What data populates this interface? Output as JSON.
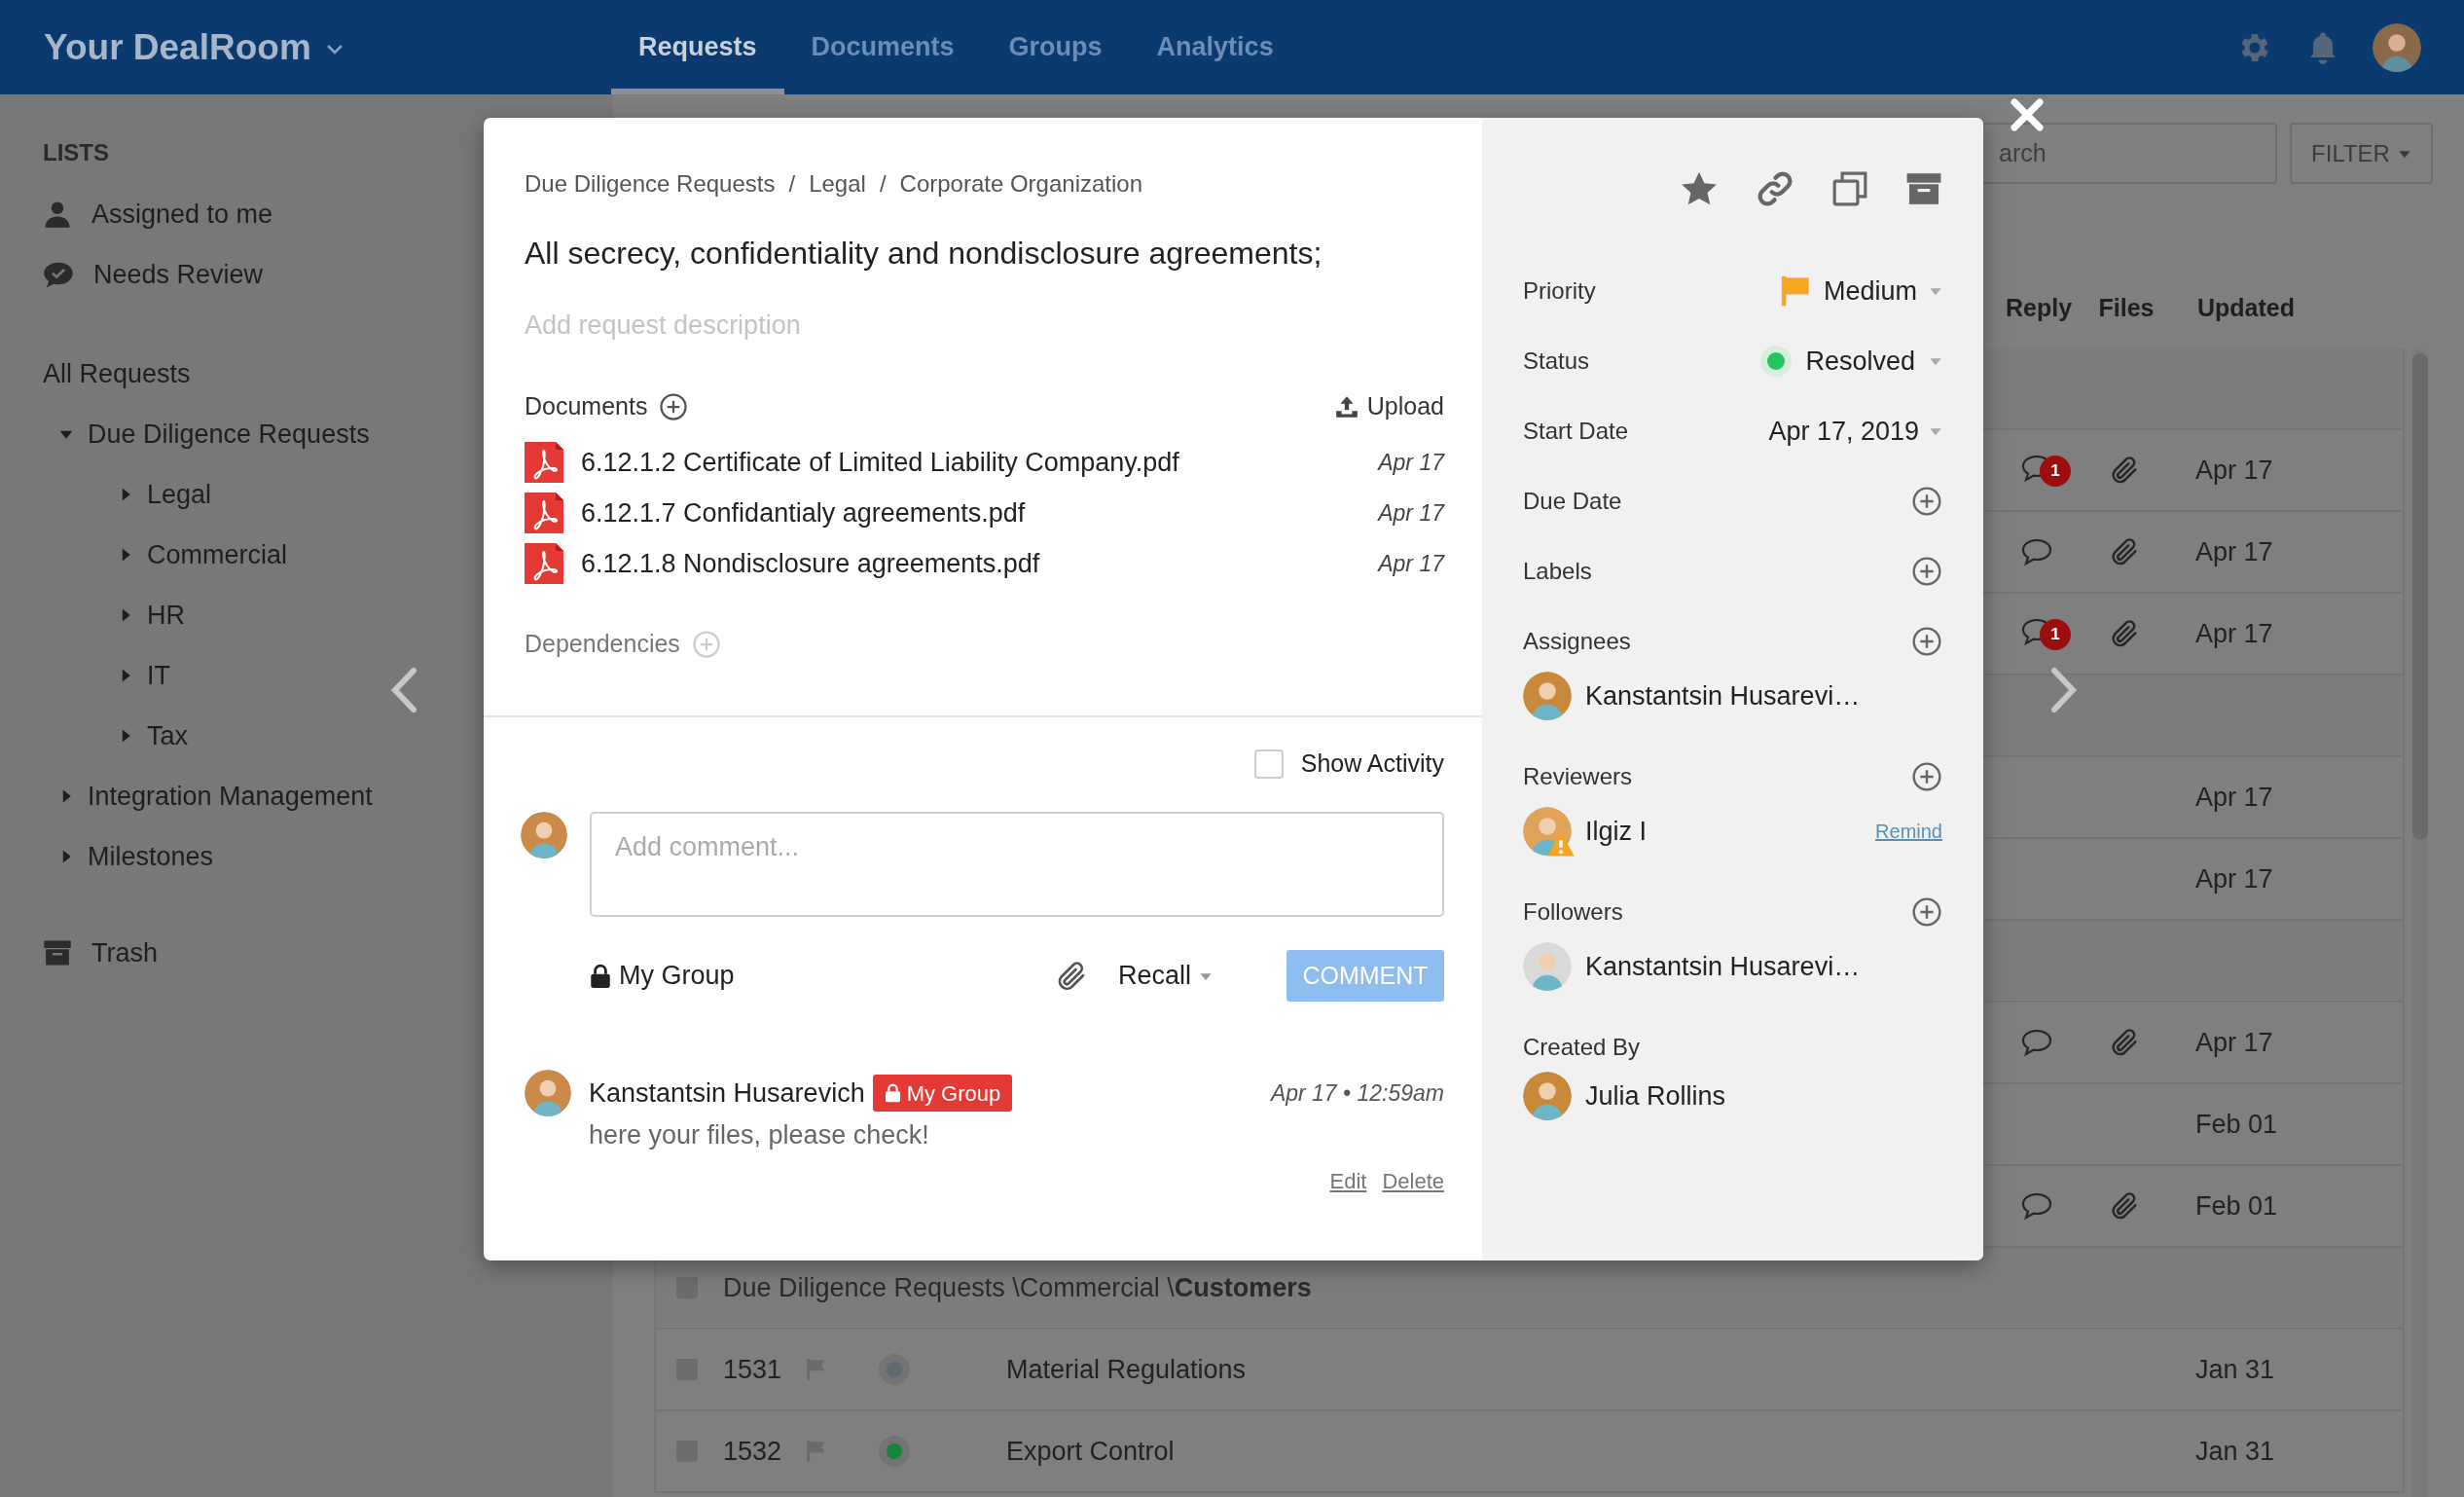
{
  "header": {
    "brand": "Your DealRoom",
    "tabs": [
      {
        "label": "Requests",
        "selected": true
      },
      {
        "label": "Documents",
        "selected": false
      },
      {
        "label": "Groups",
        "selected": false
      },
      {
        "label": "Analytics",
        "selected": false
      }
    ]
  },
  "sidebar": {
    "heading": "LISTS",
    "lists": [
      {
        "kind": "person",
        "label": "Assigned to me"
      },
      {
        "kind": "review",
        "label": "Needs Review"
      }
    ],
    "all_requests": "All Requests",
    "tree": [
      {
        "label": "Due Diligence Requests",
        "expanded": true,
        "children": [
          {
            "label": "Legal",
            "expanded": false
          },
          {
            "label": "Commercial",
            "expanded": false
          },
          {
            "label": "HR",
            "expanded": false
          },
          {
            "label": "IT",
            "expanded": false
          },
          {
            "label": "Tax",
            "expanded": false
          }
        ]
      },
      {
        "label": "Integration Management",
        "expanded": false
      },
      {
        "label": "Milestones",
        "expanded": false
      }
    ],
    "trash": "Trash"
  },
  "toolbar": {
    "search": {
      "placeholder": "arch"
    },
    "filter": "FILTER"
  },
  "table": {
    "columns": [
      "Reply",
      "Files",
      "Updated"
    ],
    "rows": [
      {
        "kind": "group"
      },
      {
        "kind": "task",
        "comment": true,
        "badge": "1",
        "files": true,
        "updated": "Apr 17"
      },
      {
        "kind": "task",
        "comment": true,
        "files": true,
        "updated": "Apr 17"
      },
      {
        "kind": "task",
        "comment": true,
        "badge": "1",
        "files": true,
        "updated": "Apr 17"
      },
      {
        "kind": "group"
      },
      {
        "kind": "task",
        "comment": false,
        "files": false,
        "updated": "Apr 17"
      },
      {
        "kind": "task",
        "comment": false,
        "files": false,
        "updated": "Apr 17"
      },
      {
        "kind": "group"
      },
      {
        "kind": "task",
        "comment": true,
        "files": true,
        "updated": "Apr 17"
      },
      {
        "kind": "task",
        "comment": false,
        "files": false,
        "updated": "Feb 01"
      },
      {
        "kind": "task",
        "comment": true,
        "files": true,
        "updated": "Feb 01"
      },
      {
        "kind": "group",
        "checked": false,
        "path": "Due Diligence Requests \\Commercial \\**Customers**"
      },
      {
        "kind": "task",
        "checked": false,
        "number": "1531",
        "color": "#5f6973",
        "title": "Material Regulations",
        "comment": false,
        "files": false,
        "updated": "Jan 31"
      },
      {
        "kind": "task",
        "checked": false,
        "number": "1532",
        "color": "#16863f",
        "title": "Export Control",
        "comment": false,
        "files": false,
        "updated": "Jan 31"
      }
    ]
  },
  "modal": {
    "breadcrumb": [
      "Due Diligence Requests",
      "Legal",
      "Corporate Organization"
    ],
    "breadcrumb_separator": "/",
    "title": "All secrecy, confidentiality and nondisclosure agreements;",
    "description": {
      "placeholder": "Add request description"
    },
    "documents": {
      "label": "Documents",
      "upload": "Upload",
      "files": [
        {
          "name": "6.12.1.2 Certificate of Limited Liability Company.pdf",
          "date": "Apr 17"
        },
        {
          "name": "6.12.1.7 Confidantialy agreements.pdf",
          "date": "Apr 17"
        },
        {
          "name": "6.12.1.8 Nondisclosure agreements.pdf",
          "date": "Apr 17"
        }
      ]
    },
    "dependencies": "Dependencies",
    "show_activity": {
      "label": "Show Activity",
      "checked": false
    },
    "composer": {
      "placeholder": "Add comment...",
      "visibility": "My Group",
      "recall": "Recall",
      "submit": "COMMENT"
    },
    "comments": [
      {
        "author": "Kanstantsin Husarevich",
        "group": "My Group",
        "time": "Apr 17 • 12:59am",
        "text": "here your files, please check!",
        "actions": [
          "Edit",
          "Delete"
        ]
      }
    ],
    "side": {
      "fields": [
        {
          "kind": "priority",
          "label": "Priority",
          "value": "Medium",
          "color": "#f5a623"
        },
        {
          "kind": "status",
          "label": "Status",
          "value": "Resolved",
          "color": "#22c55e"
        },
        {
          "kind": "date",
          "label": "Start Date",
          "value": "Apr 17, 2019"
        },
        {
          "kind": "add",
          "label": "Due Date"
        },
        {
          "kind": "add",
          "label": "Labels"
        },
        {
          "kind": "people",
          "label": "Assignees",
          "people": [
            {
              "name": "Kanstantsin Husarevi…",
              "warning": false
            }
          ]
        },
        {
          "kind": "people",
          "label": "Reviewers",
          "people": [
            {
              "name": "Ilgiz I",
              "warning": true,
              "action": "Remind"
            }
          ]
        },
        {
          "kind": "people",
          "label": "Followers",
          "people": [
            {
              "name": "Kanstantsin Husarevi…",
              "warning": false
            }
          ]
        },
        {
          "kind": "creator",
          "label": "Created By",
          "people": [
            {
              "name": "Julia Rollins",
              "warning": false
            }
          ]
        }
      ]
    }
  }
}
